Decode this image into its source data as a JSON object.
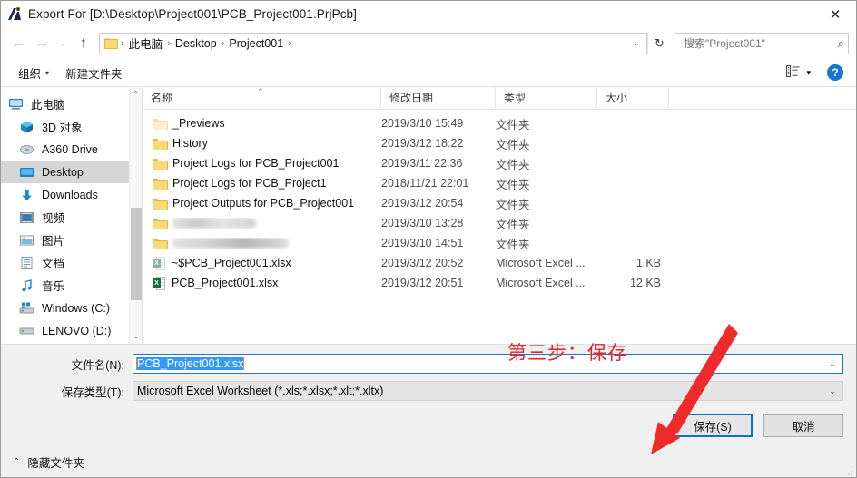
{
  "window": {
    "title": "Export For [D:\\Desktop\\Project001\\PCB_Project001.PrjPcb]",
    "app_icon": "altium-icon",
    "close_label": "✕"
  },
  "nav": {
    "back_icon": "←",
    "forward_icon": "→",
    "recent_icon": "⌄",
    "up_icon": "↑",
    "refresh_icon": "↻",
    "breadcrumbs": [
      "此电脑",
      "Desktop",
      "Project001"
    ],
    "separator": "›",
    "dropdown_icon": "⌄"
  },
  "search": {
    "value": "",
    "placeholder": "搜索\"Project001\"",
    "icon": "⌕"
  },
  "commandbar": {
    "organize_label": "组织",
    "organize_caret": "▾",
    "new_folder_label": "新建文件夹",
    "view_caret": "▾",
    "help_label": "?"
  },
  "sidebar": {
    "items": [
      {
        "label": "此电脑",
        "icon": "this-pc-icon",
        "selected": false,
        "blurred": false
      },
      {
        "label": "3D 对象",
        "icon": "3d-objects-icon",
        "selected": false,
        "blurred": false
      },
      {
        "label": "A360 Drive",
        "icon": "a360-drive-icon",
        "selected": false,
        "blurred": false
      },
      {
        "label": "Desktop",
        "icon": "desktop-icon",
        "selected": true,
        "blurred": false
      },
      {
        "label": "Downloads",
        "icon": "downloads-icon",
        "selected": false,
        "blurred": false
      },
      {
        "label": "视频",
        "icon": "videos-icon",
        "selected": false,
        "blurred": false
      },
      {
        "label": "图片",
        "icon": "pictures-icon",
        "selected": false,
        "blurred": false
      },
      {
        "label": "文档",
        "icon": "documents-icon",
        "selected": false,
        "blurred": false
      },
      {
        "label": "音乐",
        "icon": "music-icon",
        "selected": false,
        "blurred": false
      },
      {
        "label": "Windows (C:)",
        "icon": "windows-drive-icon",
        "selected": false,
        "blurred": false
      },
      {
        "label": "LENOVO (D:)",
        "icon": "drive-icon",
        "selected": false,
        "blurred": false
      },
      {
        "label": "",
        "icon": "drive-icon",
        "selected": false,
        "blurred": true
      },
      {
        "label": "",
        "icon": "drive-icon",
        "selected": false,
        "blurred": true
      }
    ],
    "scroll_up_icon": "⌃",
    "scroll_down_icon": "⌄"
  },
  "filelist": {
    "columns": [
      "名称",
      "修改日期",
      "类型",
      "大小"
    ],
    "sort_indicator": "⌃",
    "rows": [
      {
        "name": "_Previews",
        "icon": "folder-pale-icon",
        "date": "2019/3/10 15:49",
        "type": "文件夹",
        "size": "",
        "blurred": false
      },
      {
        "name": "History",
        "icon": "folder-icon",
        "date": "2019/3/12 18:22",
        "type": "文件夹",
        "size": "",
        "blurred": false
      },
      {
        "name": "Project Logs for PCB_Project001",
        "icon": "folder-icon",
        "date": "2019/3/11 22:36",
        "type": "文件夹",
        "size": "",
        "blurred": false
      },
      {
        "name": "Project Logs for PCB_Project1",
        "icon": "folder-icon",
        "date": "2018/11/21 22:01",
        "type": "文件夹",
        "size": "",
        "blurred": false
      },
      {
        "name": "Project Outputs for PCB_Project001",
        "icon": "folder-icon",
        "date": "2019/3/12 20:54",
        "type": "文件夹",
        "size": "",
        "blurred": false
      },
      {
        "name": "",
        "icon": "folder-icon",
        "date": "2019/3/10 13:28",
        "type": "文件夹",
        "size": "",
        "blurred": true
      },
      {
        "name": "",
        "icon": "folder-icon",
        "date": "2019/3/10 14:51",
        "type": "文件夹",
        "size": "",
        "blurred": true
      },
      {
        "name": "~$PCB_Project001.xlsx",
        "icon": "excel-file-faded-icon",
        "date": "2019/3/12 20:52",
        "type": "Microsoft Excel ...",
        "size": "1 KB",
        "blurred": false
      },
      {
        "name": "PCB_Project001.xlsx",
        "icon": "excel-file-icon",
        "date": "2019/3/12 20:51",
        "type": "Microsoft Excel ...",
        "size": "12 KB",
        "blurred": false
      }
    ]
  },
  "form": {
    "filename_label": "文件名(N):",
    "filename_value": "PCB_Project001.xlsx",
    "filetype_label": "保存类型(T):",
    "filetype_value": "Microsoft Excel Worksheet (*.xls;*.xlsx;*.xlt;*.xltx)",
    "dropdown_icon": "⌄"
  },
  "buttons": {
    "save_label": "保存(S)",
    "cancel_label": "取消"
  },
  "footer": {
    "hide_folders_label": "隐藏文件夹",
    "chevron": "⌃"
  },
  "annotation": {
    "text": "第三步：保存",
    "color": "#e8222a"
  },
  "colors": {
    "accent": "#0a73c4",
    "selection": "#3399ff",
    "folder": "#fbd978",
    "excel_green": "#1d7044",
    "annotation_red": "#e8222a"
  }
}
